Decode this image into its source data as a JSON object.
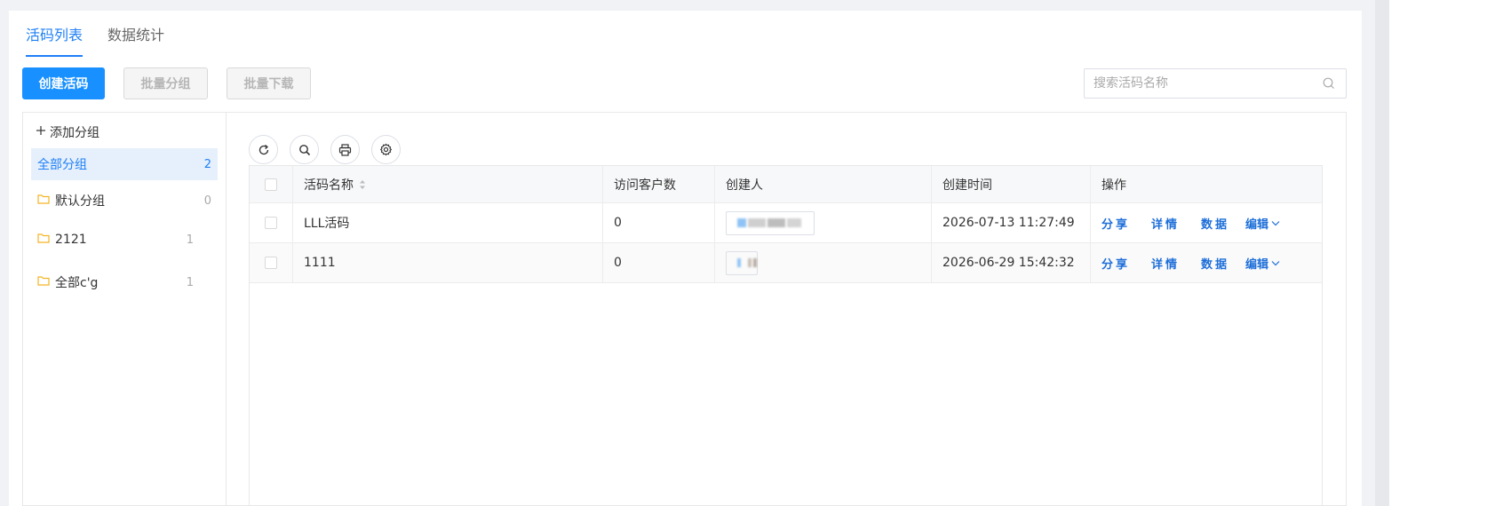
{
  "tabs": [
    {
      "label": "活码列表",
      "active": true
    },
    {
      "label": "数据统计",
      "active": false
    }
  ],
  "actions": {
    "create": "创建活码",
    "batch_group": "批量分组",
    "batch_download": "批量下载"
  },
  "search": {
    "placeholder": "搜索活码名称"
  },
  "sidebar": {
    "add_group": "添加分组",
    "groups": [
      {
        "name": "全部分组",
        "count": "2",
        "active": true
      },
      {
        "name": "默认分组",
        "count": "0"
      },
      {
        "name": "2121",
        "count": "1"
      },
      {
        "name": "全部c'g",
        "count": "1"
      }
    ]
  },
  "toolbar": [
    "refresh-icon",
    "search-icon",
    "print-icon",
    "settings-icon"
  ],
  "table": {
    "headers": [
      "活码名称",
      "访问客户数",
      "创建人",
      "创建时间",
      "操作"
    ],
    "rows": [
      {
        "name": "LLL活码",
        "visitors": "0",
        "created": "2026-07-13 11:27:49"
      },
      {
        "name": "1111",
        "visitors": "0",
        "created": "2026-06-29 15:42:32"
      }
    ],
    "ops": {
      "share": "分享",
      "detail": "详情",
      "data": "数据",
      "edit": "编辑"
    }
  },
  "colors": {
    "accent": "#1890ff",
    "link": "#1e6fd9",
    "folder": "#f5b324"
  }
}
